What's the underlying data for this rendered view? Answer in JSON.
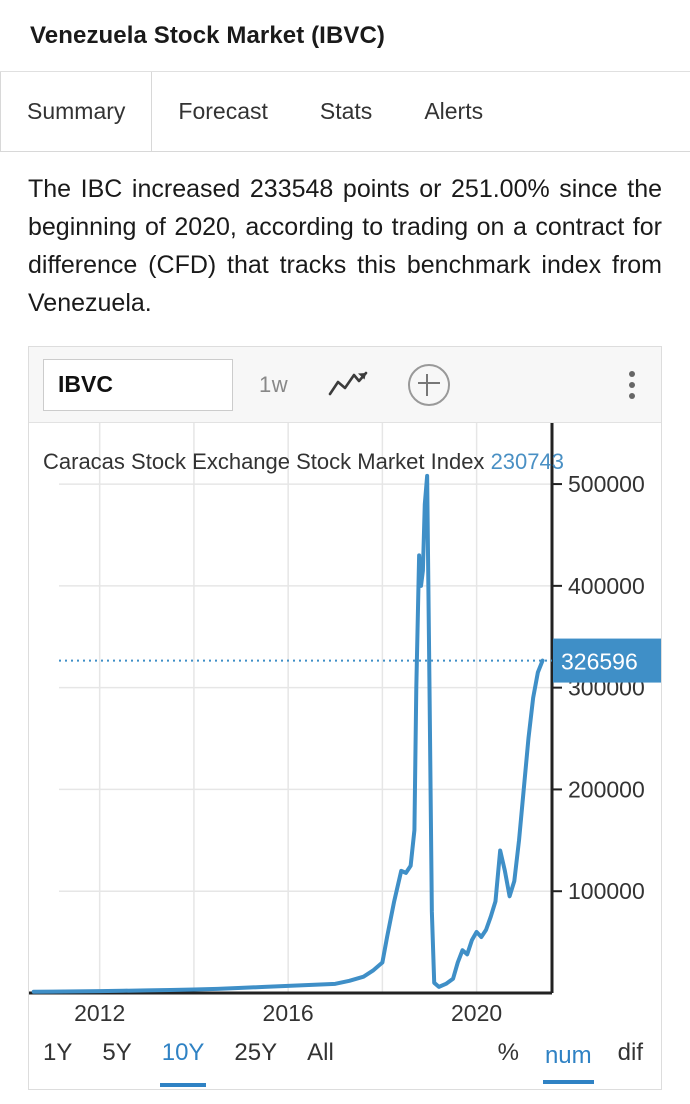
{
  "header": {
    "title": "Venezuela Stock Market (IBVC)"
  },
  "tabs": [
    {
      "label": "Summary",
      "active": true
    },
    {
      "label": "Forecast",
      "active": false
    },
    {
      "label": "Stats",
      "active": false
    },
    {
      "label": "Alerts",
      "active": false
    }
  ],
  "summary": {
    "text": "The IBC increased 233548 points or 251.00% since the beginning of 2020, according to trading on a contract for difference (CFD) that tracks this benchmark index from Venezuela."
  },
  "chart_toolbar": {
    "symbol": "IBVC",
    "interval": "1w",
    "chart_type_icon": "line-chart-icon",
    "add_icon": "plus-circle-icon",
    "menu_icon": "kebab-menu-icon"
  },
  "range_controls": {
    "periods": [
      {
        "label": "1Y",
        "active": false
      },
      {
        "label": "5Y",
        "active": false
      },
      {
        "label": "10Y",
        "active": true
      },
      {
        "label": "25Y",
        "active": false
      },
      {
        "label": "All",
        "active": false
      }
    ],
    "scales": [
      {
        "label": "%",
        "active": false
      },
      {
        "label": "num",
        "active": true
      },
      {
        "label": "dif",
        "active": false
      }
    ]
  },
  "chart_data": {
    "type": "line",
    "title": "Caracas Stock Exchange Stock Market Index",
    "title_value": "230743",
    "last_value_label": "326596",
    "series_color": "#3f8fc7",
    "xlabel": "",
    "ylabel": "",
    "grid": true,
    "legend": "none",
    "yticks": [
      100000,
      200000,
      300000,
      400000,
      500000
    ],
    "ytick_labels": [
      "100000",
      "200000",
      "300000",
      "400000",
      "500000"
    ],
    "ylim": [
      0,
      560000
    ],
    "xticks": [
      2012,
      2016,
      2020
    ],
    "xtick_labels": [
      "2012",
      "2016",
      "2020"
    ],
    "xlim": [
      2010.5,
      2021.6
    ],
    "marker_line_y": 326596,
    "series": [
      {
        "name": "Caracas Stock Exchange Stock Market Index",
        "x": [
          2010.6,
          2011.0,
          2011.5,
          2012.0,
          2012.5,
          2013.0,
          2013.5,
          2014.0,
          2014.5,
          2015.0,
          2015.5,
          2016.0,
          2016.5,
          2017.0,
          2017.3,
          2017.6,
          2017.8,
          2018.0,
          2018.1,
          2018.25,
          2018.4,
          2018.5,
          2018.6,
          2018.68,
          2018.72,
          2018.78,
          2018.82,
          2018.86,
          2018.9,
          2018.95,
          2019.0,
          2019.05,
          2019.1,
          2019.2,
          2019.35,
          2019.5,
          2019.6,
          2019.7,
          2019.8,
          2019.9,
          2020.0,
          2020.1,
          2020.2,
          2020.3,
          2020.4,
          2020.5,
          2020.6,
          2020.7,
          2020.8,
          2020.9,
          2021.0,
          2021.1,
          2021.2,
          2021.3,
          2021.4
        ],
        "y": [
          1200,
          1400,
          1600,
          1800,
          2200,
          2600,
          3000,
          3500,
          4000,
          5000,
          6000,
          7000,
          8000,
          9000,
          12000,
          16000,
          22000,
          30000,
          55000,
          90000,
          120000,
          118000,
          125000,
          160000,
          300000,
          430000,
          400000,
          415000,
          480000,
          508000,
          300000,
          80000,
          10000,
          6000,
          9000,
          14000,
          30000,
          42000,
          38000,
          52000,
          60000,
          55000,
          62000,
          75000,
          90000,
          140000,
          120000,
          95000,
          110000,
          150000,
          200000,
          250000,
          290000,
          315000,
          326596
        ]
      }
    ]
  }
}
